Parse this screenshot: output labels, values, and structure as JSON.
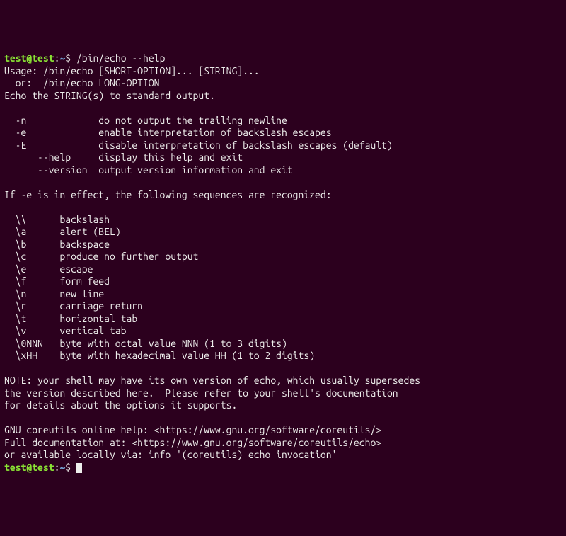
{
  "prompt": {
    "user": "test",
    "at": "@",
    "host": "test",
    "colon": ":",
    "path": "~",
    "dollar": "$ "
  },
  "command": "/bin/echo --help",
  "output": {
    "l01": "Usage: /bin/echo [SHORT-OPTION]... [STRING]...",
    "l02": "  or:  /bin/echo LONG-OPTION",
    "l03": "Echo the STRING(s) to standard output.",
    "l04": "",
    "l05": "  -n             do not output the trailing newline",
    "l06": "  -e             enable interpretation of backslash escapes",
    "l07": "  -E             disable interpretation of backslash escapes (default)",
    "l08": "      --help     display this help and exit",
    "l09": "      --version  output version information and exit",
    "l10": "",
    "l11": "If -e is in effect, the following sequences are recognized:",
    "l12": "",
    "l13": "  \\\\      backslash",
    "l14": "  \\a      alert (BEL)",
    "l15": "  \\b      backspace",
    "l16": "  \\c      produce no further output",
    "l17": "  \\e      escape",
    "l18": "  \\f      form feed",
    "l19": "  \\n      new line",
    "l20": "  \\r      carriage return",
    "l21": "  \\t      horizontal tab",
    "l22": "  \\v      vertical tab",
    "l23": "  \\0NNN   byte with octal value NNN (1 to 3 digits)",
    "l24": "  \\xHH    byte with hexadecimal value HH (1 to 2 digits)",
    "l25": "",
    "l26": "NOTE: your shell may have its own version of echo, which usually supersedes",
    "l27": "the version described here.  Please refer to your shell's documentation",
    "l28": "for details about the options it supports.",
    "l29": "",
    "l30": "GNU coreutils online help: <https://www.gnu.org/software/coreutils/>",
    "l31": "Full documentation at: <https://www.gnu.org/software/coreutils/echo>",
    "l32": "or available locally via: info '(coreutils) echo invocation'"
  }
}
